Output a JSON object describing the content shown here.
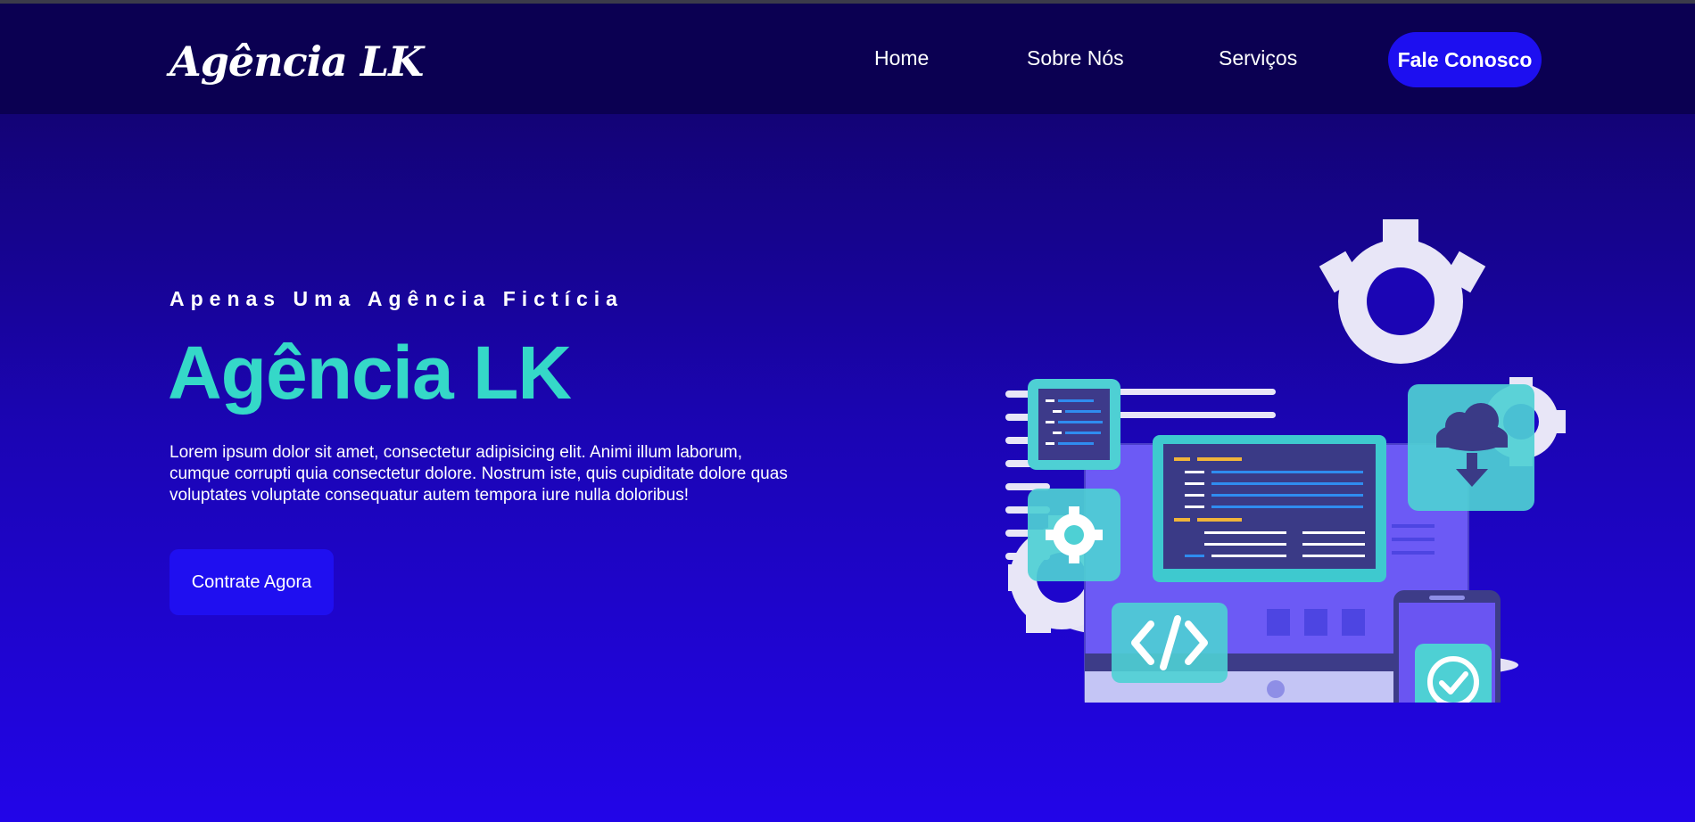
{
  "nav": {
    "logo": "Agência LK",
    "items": [
      {
        "label": "Home"
      },
      {
        "label": "Sobre Nós"
      },
      {
        "label": "Serviços"
      }
    ],
    "cta_label": "Fale Conosco"
  },
  "hero": {
    "eyebrow": "Apenas Uma Agência Fictícia",
    "title": "Agência LK",
    "description": "Lorem ipsum dolor sit amet, consectetur adipisicing elit. Animi illum laborum, cumque corrupti quia consectetur dolore. Nostrum iste, quis cupiditate dolore quas voluptates voluptate consequatur autem tempora iure nulla doloribus!",
    "button_label": "Contrate Agora"
  },
  "colors": {
    "nav_bg": "#0b0052",
    "accent": "#35d8c8",
    "button": "#1f0ff0"
  },
  "icons": [
    "gear-icon",
    "cloud-download-icon",
    "code-icon",
    "check-circle-icon",
    "monitor-icon",
    "smartphone-icon"
  ]
}
